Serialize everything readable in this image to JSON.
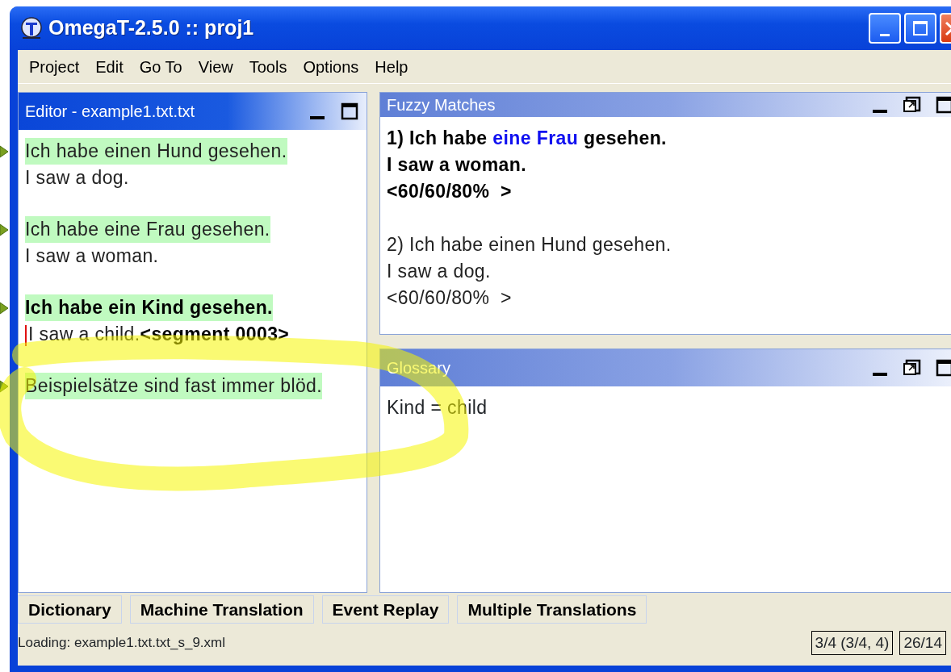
{
  "window": {
    "title": "OmegaT-2.5.0 :: proj1"
  },
  "menu": [
    "Project",
    "Edit",
    "Go To",
    "View",
    "Tools",
    "Options",
    "Help"
  ],
  "editor": {
    "title": "Editor - example1.txt.txt",
    "active": true,
    "buttons": [
      {
        "kind": "minimize"
      },
      {
        "kind": "maximize"
      }
    ],
    "segments": [
      {
        "source": "Ich habe einen Hund gesehen.",
        "target": "I saw a dog.",
        "current": false
      },
      {
        "source": "Ich habe eine Frau gesehen.",
        "target": "I saw a woman.",
        "current": false
      },
      {
        "source": "Ich habe ein Kind gesehen.",
        "target": "I saw a child.",
        "current": true,
        "marker": "<segment 0003>"
      },
      {
        "source": "Beispielsätze sind fast immer blöd.",
        "current": false
      }
    ]
  },
  "fuzzy_matches": {
    "title": "Fuzzy Matches",
    "active": false,
    "buttons": [
      {
        "kind": "minimize"
      },
      {
        "kind": "undock"
      },
      {
        "kind": "maximize"
      }
    ],
    "matches": [
      {
        "selected": true,
        "source_parts": [
          {
            "text": "1) Ich habe ",
            "differs": false
          },
          {
            "text": "eine Frau",
            "differs": true
          },
          {
            "text": " gesehen.",
            "differs": false
          }
        ],
        "target": "I saw a woman.",
        "score": "<60/60/80%  >"
      },
      {
        "selected": false,
        "source_parts": [
          {
            "text": "2) Ich habe einen Hund gesehen.",
            "differs": false
          }
        ],
        "target": "I saw a dog.",
        "score": "<60/60/80%  >"
      }
    ]
  },
  "glossary": {
    "title": "Glossary",
    "active": false,
    "buttons": [
      {
        "kind": "minimize"
      },
      {
        "kind": "undock"
      },
      {
        "kind": "maximize"
      }
    ],
    "entries": [
      "Kind = child"
    ]
  },
  "tabs": [
    "Dictionary",
    "Machine Translation",
    "Event Replay",
    "Multiple Translations"
  ],
  "status_bar": {
    "message": "Loading: example1.txt.txt_s_9.xml",
    "progress": "3/4 (3/4, 4)",
    "counts": "26/14"
  }
}
